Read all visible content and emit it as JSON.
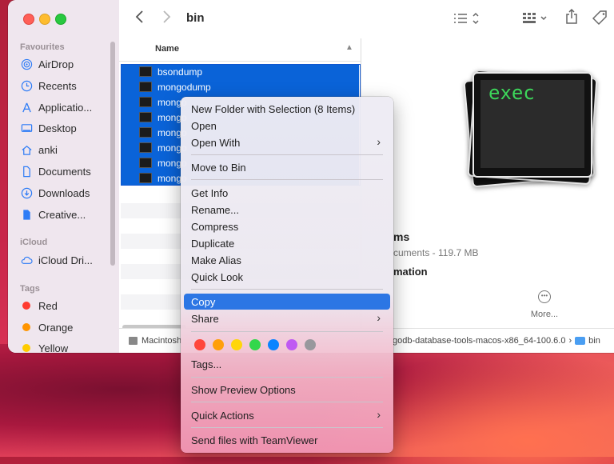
{
  "window": {
    "title": "bin"
  },
  "sidebar": {
    "favourites_heading": "Favourites",
    "favourites": [
      {
        "label": "AirDrop",
        "icon": "airdrop-icon"
      },
      {
        "label": "Recents",
        "icon": "clock-icon"
      },
      {
        "label": "Applicatio...",
        "icon": "applications-icon"
      },
      {
        "label": "Desktop",
        "icon": "desktop-icon"
      },
      {
        "label": "anki",
        "icon": "home-icon"
      },
      {
        "label": "Documents",
        "icon": "document-icon"
      },
      {
        "label": "Downloads",
        "icon": "download-icon"
      },
      {
        "label": "Creative...",
        "icon": "file-icon"
      }
    ],
    "icloud_heading": "iCloud",
    "icloud": [
      {
        "label": "iCloud Dri...",
        "icon": "cloud-icon"
      }
    ],
    "tags_heading": "Tags",
    "tags": [
      {
        "label": "Red",
        "color": "#ff3b30"
      },
      {
        "label": "Orange",
        "color": "#ff9500"
      },
      {
        "label": "Yellow",
        "color": "#ffcc00"
      }
    ]
  },
  "list": {
    "column_name": "Name",
    "rows": [
      {
        "label": "bsondump",
        "selected": true
      },
      {
        "label": "mongodump",
        "selected": true
      },
      {
        "label": "mongo",
        "selected": true
      },
      {
        "label": "mongo",
        "selected": true
      },
      {
        "label": "mongo",
        "selected": true
      },
      {
        "label": "mongo",
        "selected": true
      },
      {
        "label": "mongo",
        "selected": true
      },
      {
        "label": "mongo",
        "selected": true
      }
    ]
  },
  "preview": {
    "icon_text": "exec",
    "title": "ms",
    "subtitle": "cuments - 119.7 MB",
    "info_heading": "mation",
    "more_label": "More..."
  },
  "pathbar": {
    "left": "Macintosh",
    "right_path": "godb-database-tools-macos-x86_64-100.6.0",
    "right_sep": "›",
    "right_folder": "bin"
  },
  "context_menu": {
    "items": [
      {
        "label": "New Folder with Selection (8 Items)"
      },
      {
        "label": "Open"
      },
      {
        "label": "Open With",
        "submenu": true
      },
      {
        "label": "Move to Bin"
      },
      {
        "label": "Get Info"
      },
      {
        "label": "Rename..."
      },
      {
        "label": "Compress"
      },
      {
        "label": "Duplicate"
      },
      {
        "label": "Make Alias"
      },
      {
        "label": "Quick Look"
      },
      {
        "label": "Copy",
        "active": true
      },
      {
        "label": "Share",
        "submenu": true
      },
      {
        "label": "Tags..."
      },
      {
        "label": "Show Preview Options"
      },
      {
        "label": "Quick Actions",
        "submenu": true
      },
      {
        "label": "Send files with TeamViewer"
      }
    ],
    "submenu_arrow": "›",
    "tag_colors": [
      "#ff453a",
      "#ff9f0a",
      "#ffd60a",
      "#32d74b",
      "#0a84ff",
      "#bf5af2",
      "#98989d"
    ]
  }
}
